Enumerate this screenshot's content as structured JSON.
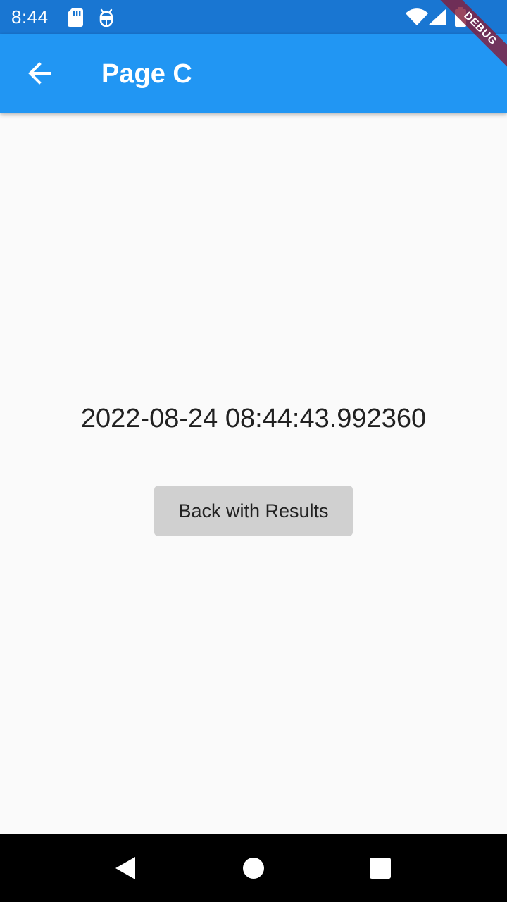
{
  "status_bar": {
    "time": "8:44",
    "icons": [
      "sd-card-icon",
      "android-debug-icon",
      "wifi-icon",
      "cell-signal-icon",
      "battery-icon"
    ]
  },
  "app_bar": {
    "title": "Page C",
    "back_icon": "arrow-back-icon"
  },
  "debug_banner": {
    "label": "DEBUG"
  },
  "main": {
    "timestamp": "2022-08-24 08:44:43.992360",
    "button_label": "Back with Results"
  },
  "nav_bar": {
    "buttons": [
      "back-triangle-icon",
      "home-circle-icon",
      "recents-square-icon"
    ]
  },
  "colors": {
    "status_bar": "#1976d2",
    "app_bar": "#2196f3",
    "background": "#fafafa",
    "button": "#d0d0d0",
    "nav_bar": "#000000"
  }
}
